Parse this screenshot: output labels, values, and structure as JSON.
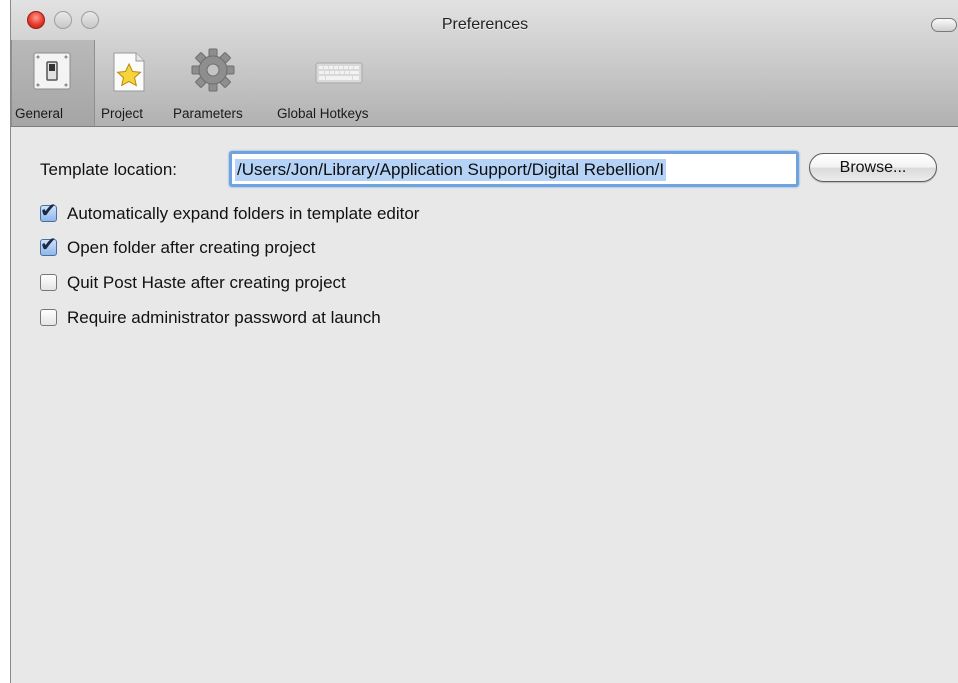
{
  "window": {
    "title": "Preferences"
  },
  "toolbar": {
    "items": [
      {
        "label": "General",
        "icon": "light-switch-icon",
        "selected": true
      },
      {
        "label": "Project",
        "icon": "star-document-icon",
        "selected": false
      },
      {
        "label": "Parameters",
        "icon": "gear-icon",
        "selected": false
      },
      {
        "label": "Global Hotkeys",
        "icon": "keyboard-icon",
        "selected": false
      }
    ]
  },
  "general": {
    "template_location_label": "Template location:",
    "template_location_value": "/Users/Jon/Library/Application Support/Digital Rebellion/I",
    "browse_label": "Browse...",
    "options": [
      {
        "label": "Automatically expand folders in template editor",
        "checked": true
      },
      {
        "label": "Open folder after creating project",
        "checked": true
      },
      {
        "label": "Quit Post Haste after creating project",
        "checked": false
      },
      {
        "label": "Require administrator password at launch",
        "checked": false
      }
    ]
  },
  "colors": {
    "close_button": "#e63a2c",
    "focus_ring": "#6fa3e0",
    "text_selection": "#b5d3f7"
  }
}
